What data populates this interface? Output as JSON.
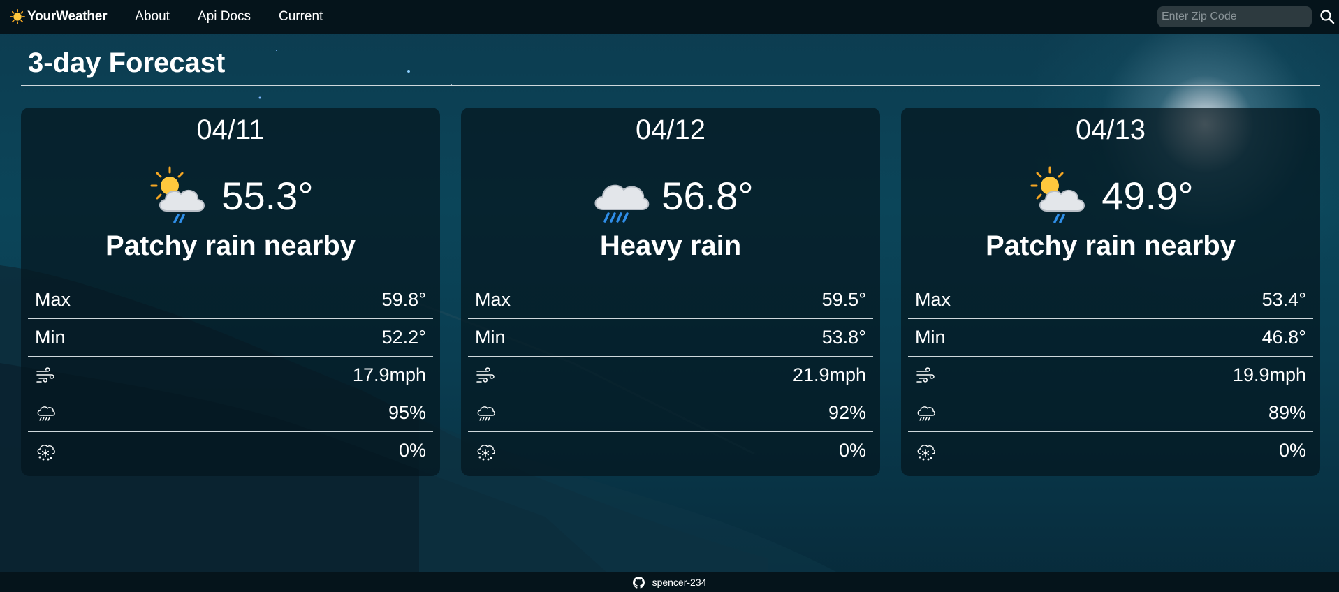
{
  "brand": {
    "name": "YourWeather"
  },
  "nav": {
    "links": [
      "About",
      "Api Docs",
      "Current"
    ]
  },
  "search": {
    "placeholder": "Enter Zip Code"
  },
  "page": {
    "title": "3-day Forecast"
  },
  "labels": {
    "max": "Max",
    "min": "Min"
  },
  "forecast": [
    {
      "date": "04/11",
      "temp": "55.3°",
      "condition": "Patchy rain nearby",
      "icon": "patchy-rain-icon",
      "max": "59.8°",
      "min": "52.2°",
      "wind": "17.9mph",
      "rain": "95%",
      "snow": "0%"
    },
    {
      "date": "04/12",
      "temp": "56.8°",
      "condition": "Heavy rain",
      "icon": "heavy-rain-icon",
      "max": "59.5°",
      "min": "53.8°",
      "wind": "21.9mph",
      "rain": "92%",
      "snow": "0%"
    },
    {
      "date": "04/13",
      "temp": "49.9°",
      "condition": "Patchy rain nearby",
      "icon": "patchy-rain-icon",
      "max": "53.4°",
      "min": "46.8°",
      "wind": "19.9mph",
      "rain": "89%",
      "snow": "0%"
    }
  ],
  "footer": {
    "username": "spencer-234"
  },
  "colors": {
    "nav_bg": "#05141b",
    "card_bg": "#04161e",
    "accent_sun": "#f5b82e",
    "rain_drop": "#2f8ee8"
  }
}
